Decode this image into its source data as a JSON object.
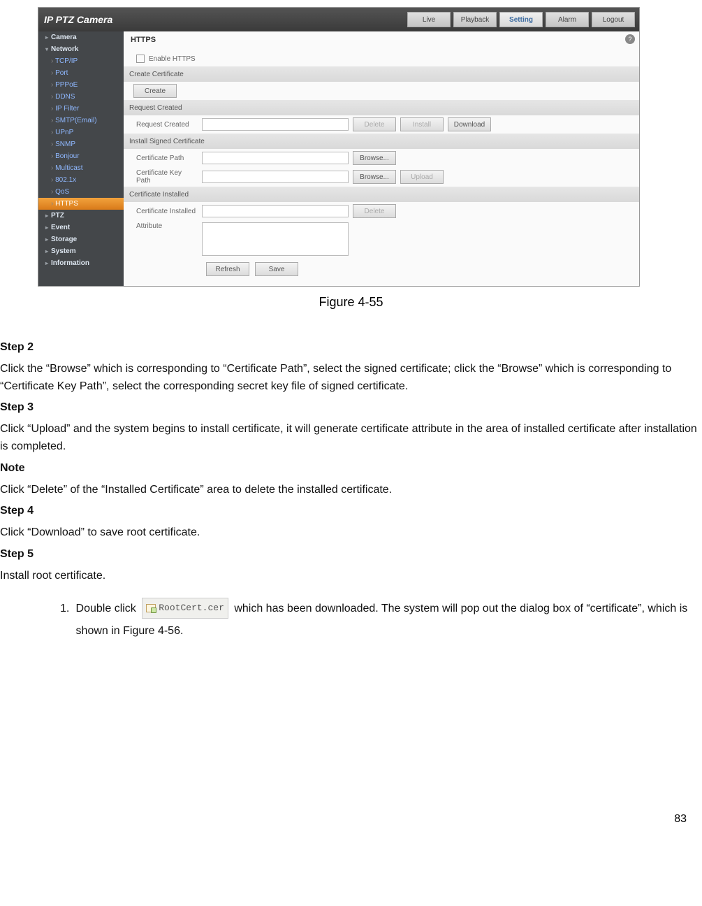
{
  "screenshot": {
    "logo": "IP PTZ Camera",
    "topnav": {
      "live": "Live",
      "playback": "Playback",
      "setting": "Setting",
      "alarm": "Alarm",
      "logout": "Logout"
    },
    "sidebar": {
      "camera": "Camera",
      "network": "Network",
      "items": [
        "TCP/IP",
        "Port",
        "PPPoE",
        "DDNS",
        "IP Filter",
        "SMTP(Email)",
        "UPnP",
        "SNMP",
        "Bonjour",
        "Multicast",
        "802.1x",
        "QoS",
        "HTTPS"
      ],
      "ptz": "PTZ",
      "event": "Event",
      "storage": "Storage",
      "system": "System",
      "information": "Information"
    },
    "panel": {
      "title": "HTTPS",
      "enable_label": "Enable HTTPS",
      "sec_create": "Create Certificate",
      "btn_create": "Create",
      "sec_request": "Request Created",
      "lbl_request": "Request Created",
      "btn_delete": "Delete",
      "btn_install": "Install",
      "btn_download": "Download",
      "sec_install": "Install Signed Certificate",
      "lbl_cert_path": "Certificate Path",
      "lbl_key_path": "Certificate Key Path",
      "btn_browse": "Browse...",
      "btn_upload": "Upload",
      "sec_installed": "Certificate Installed",
      "lbl_installed": "Certificate Installed",
      "lbl_attribute": "Attribute",
      "btn_refresh": "Refresh",
      "btn_save": "Save"
    }
  },
  "doc": {
    "figure_caption": "Figure 4-55",
    "step2_h": "Step 2",
    "step2_p": "Click the “Browse” which is corresponding to “Certificate Path”, select the signed certificate; click the “Browse” which is corresponding to “Certificate Key Path”, select the corresponding secret key file of signed certificate.",
    "step3_h": "Step 3",
    "step3_p": "Click “Upload” and the system begins to install certificate, it will generate certificate attribute in the area of installed certificate after installation is completed.",
    "note_h": "Note",
    "note_p": "Click “Delete” of the “Installed Certificate” area to delete the installed certificate.",
    "step4_h": "Step 4",
    "step4_p": "Click “Download” to save root certificate.",
    "step5_h": "Step 5",
    "step5_p": "Install root certificate.",
    "li1_a": "Double click ",
    "li1_file": "RootCert.cer",
    "li1_b": " which has been downloaded. The system will pop out the dialog box of “certificate”, which is shown in Figure 4-56.",
    "page_num": "83"
  }
}
